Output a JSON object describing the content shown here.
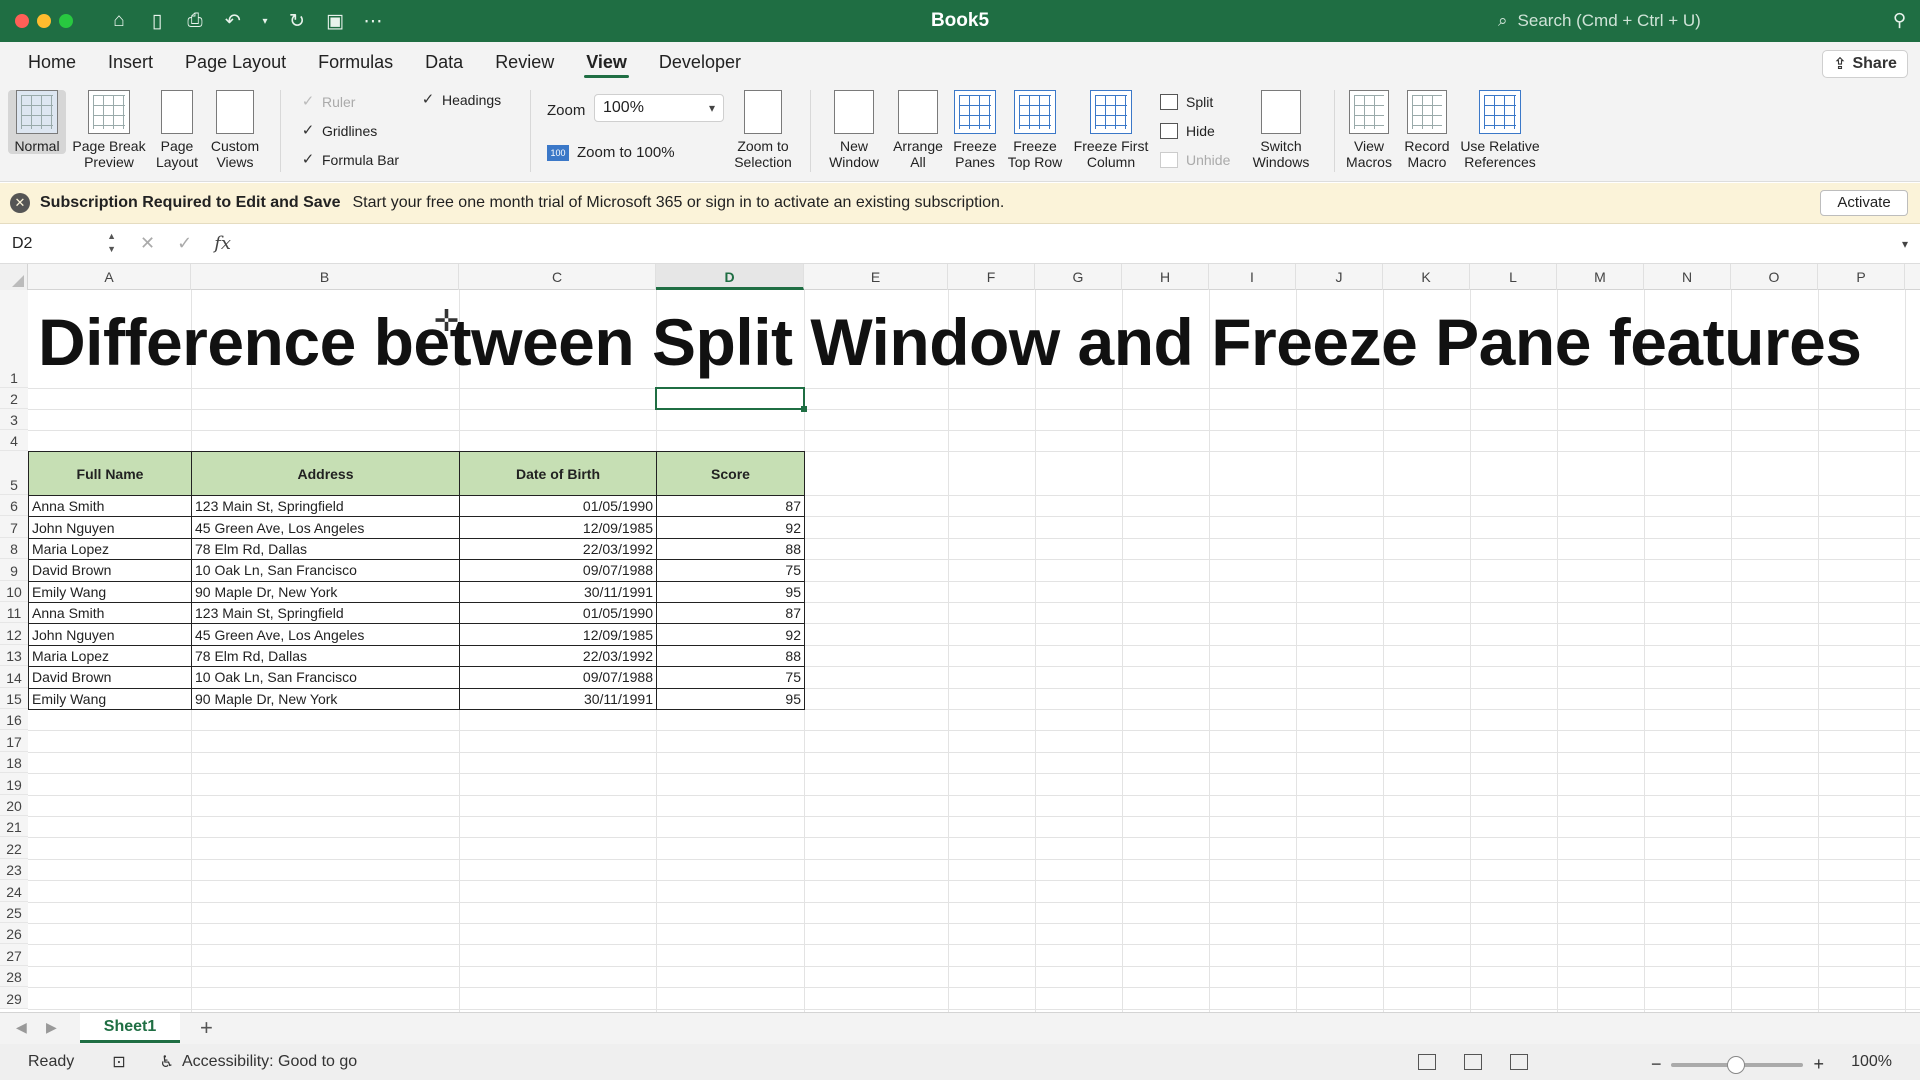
{
  "window": {
    "title": "Book5",
    "search_placeholder": "Search (Cmd + Ctrl + U)"
  },
  "tabs": [
    "Home",
    "Insert",
    "Page Layout",
    "Formulas",
    "Data",
    "Review",
    "View",
    "Developer"
  ],
  "active_tab": "View",
  "share_label": "Share",
  "ribbon": {
    "normal": "Normal",
    "page_break": [
      "Page Break",
      "Preview"
    ],
    "page_layout": [
      "Page",
      "Layout"
    ],
    "custom_views": [
      "Custom",
      "Views"
    ],
    "ruler": "Ruler",
    "gridlines": "Gridlines",
    "formula_bar": "Formula Bar",
    "headings": "Headings",
    "zoom_label": "Zoom",
    "zoom_value": "100%",
    "zoom_100": "Zoom to 100%",
    "zoom_selection": [
      "Zoom to",
      "Selection"
    ],
    "new_window": [
      "New",
      "Window"
    ],
    "arrange_all": [
      "Arrange",
      "All"
    ],
    "freeze_panes": [
      "Freeze",
      "Panes"
    ],
    "freeze_top_row": [
      "Freeze",
      "Top Row"
    ],
    "freeze_first_col": [
      "Freeze First",
      "Column"
    ],
    "split": "Split",
    "hide": "Hide",
    "unhide": "Unhide",
    "switch_windows": [
      "Switch",
      "Windows"
    ],
    "view_macros": [
      "View",
      "Macros"
    ],
    "record_macro": [
      "Record",
      "Macro"
    ],
    "use_relative": [
      "Use Relative",
      "References"
    ]
  },
  "notification": {
    "title": "Subscription Required to Edit and Save",
    "message": "Start your free one month trial of Microsoft 365 or sign in to activate an existing subscription.",
    "button": "Activate"
  },
  "formula_bar": {
    "name_box": "D2",
    "fx": "fx"
  },
  "columns": [
    "A",
    "B",
    "C",
    "D",
    "E",
    "F",
    "G",
    "H",
    "I",
    "J",
    "K",
    "L",
    "M",
    "N",
    "O",
    "P"
  ],
  "rows": [
    "1",
    "2",
    "3",
    "4",
    "5",
    "6",
    "7",
    "8",
    "9",
    "10",
    "11",
    "12",
    "13",
    "14",
    "15",
    "16",
    "17",
    "18",
    "19",
    "20",
    "21",
    "22",
    "23",
    "24",
    "25",
    "26",
    "27",
    "28",
    "29"
  ],
  "sheet_title": "Difference between Split Window and Freeze Pane features",
  "table": {
    "headers": [
      "Full Name",
      "Address",
      "Date of Birth",
      "Score"
    ],
    "rows": [
      [
        "Anna Smith",
        "123 Main St, Springfield",
        "01/05/1990",
        "87"
      ],
      [
        "John Nguyen",
        "45 Green Ave, Los Angeles",
        "12/09/1985",
        "92"
      ],
      [
        "Maria Lopez",
        "78 Elm Rd, Dallas",
        "22/03/1992",
        "88"
      ],
      [
        "David Brown",
        "10 Oak Ln, San Francisco",
        "09/07/1988",
        "75"
      ],
      [
        "Emily Wang",
        "90 Maple Dr, New York",
        "30/11/1991",
        "95"
      ],
      [
        "Anna Smith",
        "123 Main St, Springfield",
        "01/05/1990",
        "87"
      ],
      [
        "John Nguyen",
        "45 Green Ave, Los Angeles",
        "12/09/1985",
        "92"
      ],
      [
        "Maria Lopez",
        "78 Elm Rd, Dallas",
        "22/03/1992",
        "88"
      ],
      [
        "David Brown",
        "10 Oak Ln, San Francisco",
        "09/07/1988",
        "75"
      ],
      [
        "Emily Wang",
        "90 Maple Dr, New York",
        "30/11/1991",
        "95"
      ]
    ]
  },
  "sheet_tab": "Sheet1",
  "status": {
    "ready": "Ready",
    "accessibility": "Accessibility: Good to go",
    "zoom": "100%"
  },
  "colors": {
    "brand": "#1f6e43",
    "header_fill": "#c6dfb4",
    "notice_bg": "#fbf3d9"
  }
}
